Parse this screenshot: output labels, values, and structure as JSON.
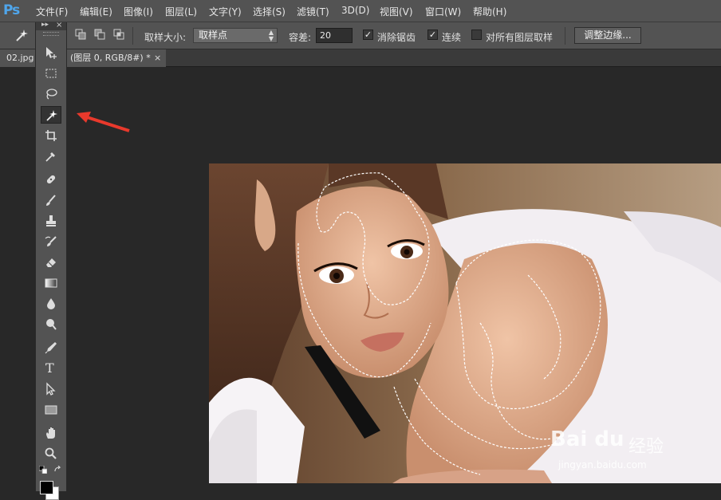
{
  "app": {
    "logo": "Ps"
  },
  "menu": [
    "文件(F)",
    "编辑(E)",
    "图像(I)",
    "图层(L)",
    "文字(Y)",
    "选择(S)",
    "滤镜(T)",
    "3D(D)",
    "视图(V)",
    "窗口(W)",
    "帮助(H)"
  ],
  "options": {
    "sample_size_label": "取样大小:",
    "sample_size_value": "取样点",
    "tolerance_label": "容差:",
    "tolerance_value": "20",
    "antialias_label": "消除锯齿",
    "antialias_checked": true,
    "contiguous_label": "连续",
    "contiguous_checked": true,
    "sample_all_label": "对所有图层取样",
    "sample_all_checked": false,
    "refine_edge_label": "调整边缘...",
    "check_glyph": "✓"
  },
  "document": {
    "tab_prefix": "02.jpg",
    "tab_suffix": "(图层 0, RGB/8#) *",
    "close_glyph": "×"
  },
  "toolbox": {
    "expand_glyph": "▸▸",
    "close_glyph": "×",
    "tools": [
      "move-tool",
      "marquee-tool",
      "lasso-tool",
      "magic-wand-tool",
      "crop-tool",
      "eyedropper-tool",
      "healing-brush-tool",
      "brush-tool",
      "clone-stamp-tool",
      "history-brush-tool",
      "eraser-tool",
      "gradient-tool",
      "blur-tool",
      "dodge-tool",
      "pen-tool",
      "type-tool",
      "path-selection-tool",
      "rectangle-tool",
      "hand-tool",
      "zoom-tool"
    ],
    "active_tool": "magic-wand-tool",
    "type_tool_glyph": "T"
  },
  "annotation": {
    "color": "#e8392c"
  },
  "watermark": {
    "logo": "Bai du",
    "cn": "经验",
    "url": "jingyan.baidu.com"
  }
}
